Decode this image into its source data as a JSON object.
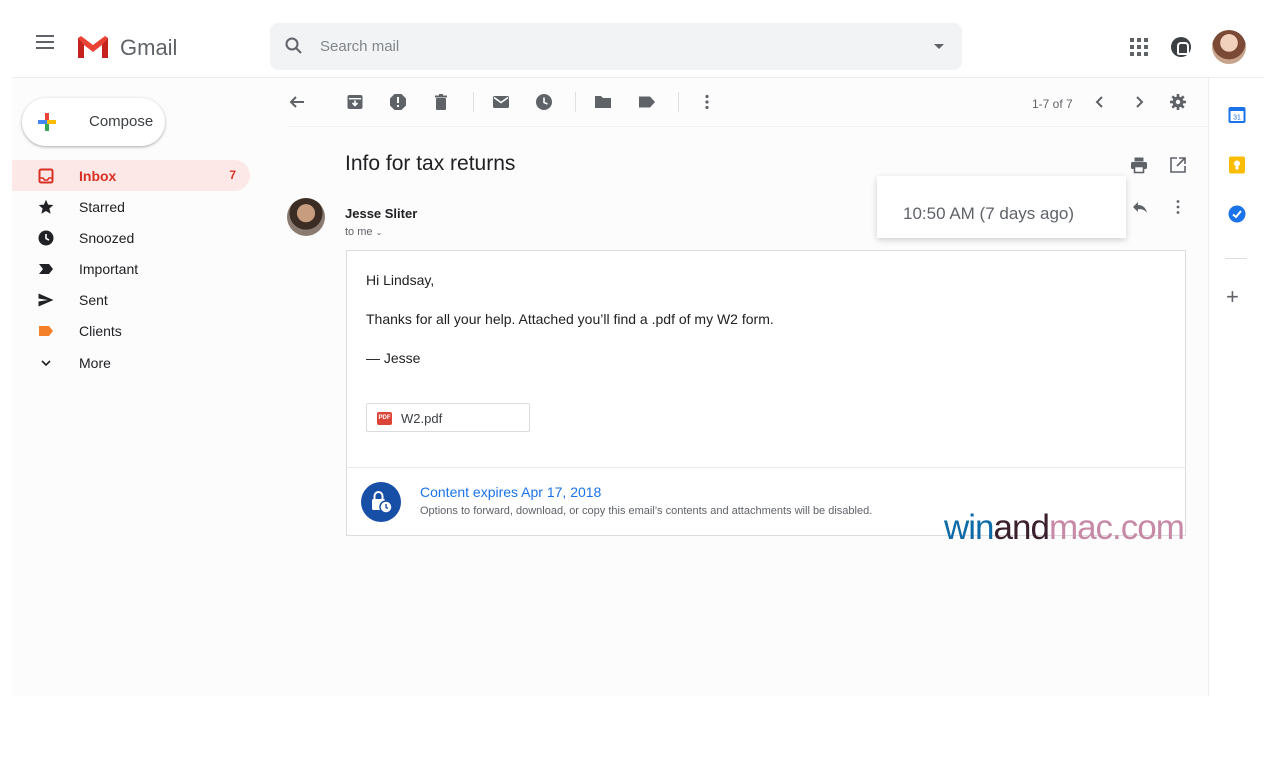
{
  "header": {
    "app_name": "Gmail",
    "search_placeholder": "Search mail"
  },
  "compose": {
    "label": "Compose"
  },
  "sidebar": {
    "items": [
      {
        "label": "Inbox",
        "count": "7",
        "icon": "inbox-icon",
        "active": true
      },
      {
        "label": "Starred",
        "icon": "star-icon"
      },
      {
        "label": "Snoozed",
        "icon": "clock-icon"
      },
      {
        "label": "Important",
        "icon": "important-icon"
      },
      {
        "label": "Sent",
        "icon": "send-icon"
      },
      {
        "label": "Clients",
        "icon": "label-icon"
      },
      {
        "label": "More",
        "icon": "chevron-down-icon"
      }
    ]
  },
  "toolbar": {
    "pager": "1-7 of 7"
  },
  "message": {
    "subject": "Info for tax returns",
    "sender": "Jesse Sliter",
    "recipient": "to me",
    "timestamp": "10:50 AM (7 days ago)",
    "body": [
      "Hi Lindsay,",
      "Thanks for all your help. Attached you’ll find a .pdf of my W2 form.",
      "— Jesse"
    ],
    "attachment": {
      "name": "W2.pdf",
      "type": "PDF"
    },
    "confidential": {
      "title": "Content expires Apr 17, 2018",
      "subtitle": "Options to forward, download, or copy this email’s contents and attachments will be disabled."
    }
  },
  "watermark": {
    "part1": "win",
    "part2": "and",
    "part3": "mac.com"
  },
  "colors": {
    "accent_red": "#d93025",
    "inbox_active_bg": "#fce8e6",
    "link_blue": "#1a73e8",
    "confidential_blue": "#174ea6"
  }
}
